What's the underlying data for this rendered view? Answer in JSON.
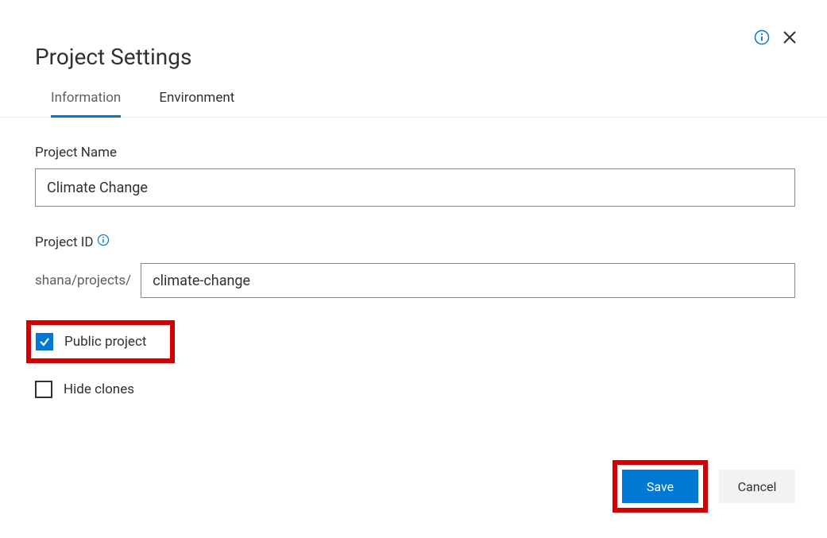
{
  "header": {
    "title": "Project Settings"
  },
  "tabs": {
    "information_label": "Information",
    "environment_label": "Environment",
    "active": "Information"
  },
  "form": {
    "project_name_label": "Project Name",
    "project_name_value": "Climate Change",
    "project_id_label": "Project ID",
    "project_id_prefix": "shana/projects/",
    "project_id_value": "climate-change",
    "public_project_label": "Public project",
    "public_project_checked": true,
    "hide_clones_label": "Hide clones",
    "hide_clones_checked": false
  },
  "buttons": {
    "save_label": "Save",
    "cancel_label": "Cancel"
  },
  "icons": {
    "info": "info-icon",
    "close": "close-icon",
    "check": "check-icon"
  },
  "highlights": {
    "public_project": true,
    "save_button": true
  },
  "colors": {
    "primary": "#0078d4",
    "highlight": "#d20000",
    "text": "#323130",
    "muted": "#605e5c"
  }
}
